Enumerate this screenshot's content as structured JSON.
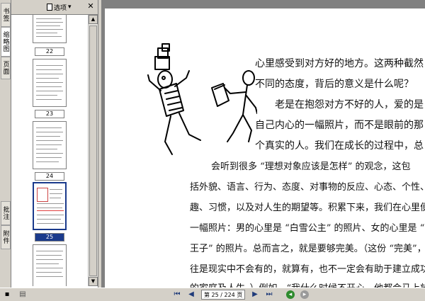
{
  "nav_tabs": [
    "书签",
    "缩略图",
    "页面",
    "批注",
    "附件"
  ],
  "thumbnail_panel": {
    "options_label": "选项",
    "page_labels": [
      "22",
      "23",
      "24",
      "25"
    ],
    "selected_page": "25"
  },
  "document": {
    "lines": [
      "心里感受到对方好的地方。这两种截然",
      "不同的态度，背后的意义是什么呢？",
      "老是在抱怨对方不好的人，爱的是",
      "自己内心的一幅照片，而不是眼前的那",
      "个真实的人。我们在成长的过程中，总",
      "会听到很多 “理想对象应该是怎样” 的观念，这包",
      "括外貌、语言、行为、态度、对事物的反应、心态、个性、兴",
      "趣、习惯，以及对人生的期望等。积累下来，我们在心里便有了",
      "一幅照片：男的心里是 “白雪公主” 的照片、女的心里是 “白马",
      "王子” 的照片。总而言之，就是要够完美。（这份 “完美”，往",
      "往是现实中不会有的，就算有，也不一定会有助于建立成功快乐",
      "的家庭及人生。）例如，“我什么时候不开心，他都会马上放下手"
    ]
  },
  "statusbar": {
    "page_indicator": "第 25 / 224 页"
  },
  "colors": {
    "selection": "#1a3a8c",
    "chrome": "#d4d0c8",
    "document_bg": "#808080"
  },
  "icons": [
    "options-icon",
    "close-icon",
    "first-page-icon",
    "previous-page-icon",
    "next-page-icon",
    "last-page-icon",
    "go-back-icon",
    "go-forward-icon"
  ]
}
